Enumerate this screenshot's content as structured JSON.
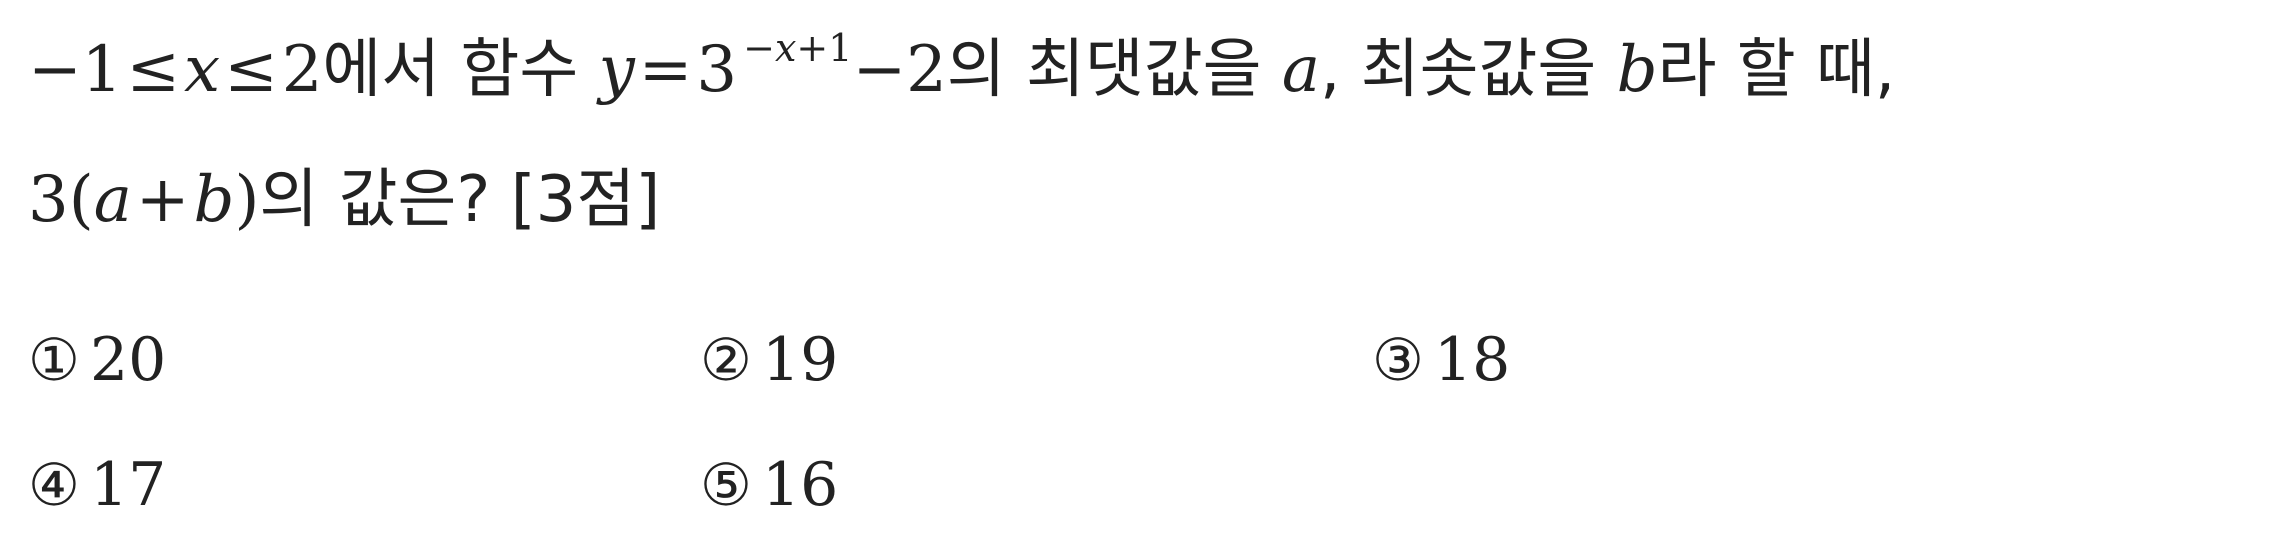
{
  "question": {
    "line1": {
      "t1": "−1",
      "le1": "≤",
      "x": "x",
      "le2": "≤",
      "t2": "2",
      "t3": "에서 함수 ",
      "y": "y",
      "eq": "=",
      "three": "3",
      "exp_minus": "−",
      "exp_x": "x",
      "exp_plus1": "+1",
      "minus2": "−2",
      "t4": "의 최댓값을 ",
      "a": "a",
      "t5": ", 최솟값을 ",
      "b": "b",
      "t6": "라 할 때,"
    },
    "line2": {
      "three": "3",
      "open": "(",
      "a": "a",
      "plus": "+",
      "b": "b",
      "close": ")",
      "t1": "의 값은? [3점]"
    }
  },
  "choices": [
    {
      "num": "①",
      "value": "20"
    },
    {
      "num": "②",
      "value": "19"
    },
    {
      "num": "③",
      "value": "18"
    },
    {
      "num": "④",
      "value": "17"
    },
    {
      "num": "⑤",
      "value": "16"
    }
  ]
}
